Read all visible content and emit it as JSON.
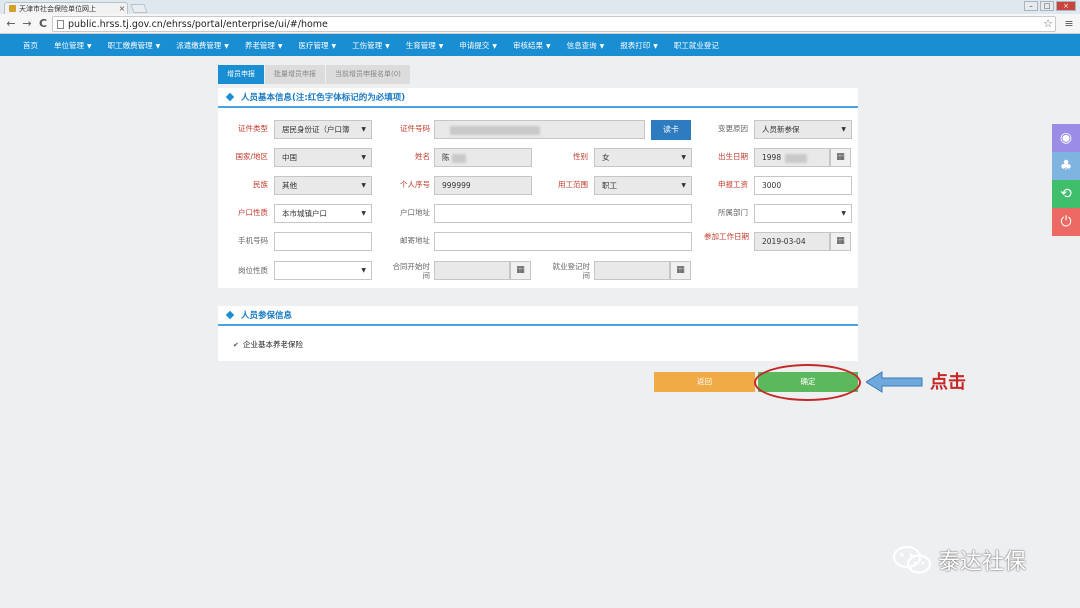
{
  "browser": {
    "tab_title": "天津市社会保险单位网上",
    "tab_close": "×",
    "url": "public.hrss.tj.gov.cn/ehrss/portal/enterprise/ui/#/home",
    "back": "←",
    "forward": "→",
    "reload": "C",
    "star": "☆",
    "menu": "≡",
    "win_min": "–",
    "win_max": "□",
    "win_close": "×"
  },
  "nav": {
    "items": [
      {
        "label": "首页",
        "caret": ""
      },
      {
        "label": "单位管理",
        "caret": "▼"
      },
      {
        "label": "职工缴费管理",
        "caret": "▼"
      },
      {
        "label": "派遣缴费管理",
        "caret": "▼"
      },
      {
        "label": "养老管理",
        "caret": "▼"
      },
      {
        "label": "医疗管理",
        "caret": "▼"
      },
      {
        "label": "工伤管理",
        "caret": "▼"
      },
      {
        "label": "生育管理",
        "caret": "▼"
      },
      {
        "label": "申请提交",
        "caret": "▼"
      },
      {
        "label": "审核结果",
        "caret": "▼"
      },
      {
        "label": "信息查询",
        "caret": "▼"
      },
      {
        "label": "报表打印",
        "caret": "▼"
      },
      {
        "label": "职工就业登记",
        "caret": ""
      }
    ]
  },
  "tabs": [
    "增员申报",
    "批量增员申报",
    "当前增员申报名单(0)"
  ],
  "basic": {
    "title": "人员基本信息(注:红色字体标记的为必填项)",
    "id_type_label": "证件类型",
    "id_type_value": "居民身份证（户口簿",
    "id_no_label": "证件号码",
    "read_card": "读卡",
    "change_reason_label": "变更原因",
    "change_reason_value": "人员新参保",
    "country_label": "国家/地区",
    "country_value": "中国",
    "name_label": "姓名",
    "name_value": "陈",
    "gender_label": "性别",
    "gender_value": "女",
    "birth_label": "出生日期",
    "birth_value": "1998",
    "ethnic_label": "民族",
    "ethnic_value": "其他",
    "serial_label": "个人序号",
    "serial_value": "999999",
    "emp_scope_label": "用工范围",
    "emp_scope_value": "职工",
    "wage_label": "申报工资",
    "wage_value": "3000",
    "hukou_label": "户口性质",
    "hukou_value": "本市城镇户口",
    "hukou_addr_label": "户口地址",
    "dept_label": "所属部门",
    "phone_label": "手机号码",
    "mail_addr_label": "邮寄地址",
    "work_date_label": "参加工作日期",
    "work_date_value": "2019-03-04",
    "post_label": "岗位性质",
    "contract_label": "合同开始时间",
    "reg_label": "就业登记时间",
    "dropdown": "▼",
    "calendar": "▦"
  },
  "insurance": {
    "title": "人员参保信息",
    "checkmark": "✔",
    "item": "企业基本养老保险"
  },
  "actions": {
    "cancel": "返回",
    "ok": "确定"
  },
  "annotation": {
    "click": "点击"
  },
  "watermark": {
    "text": "泰达社保"
  },
  "colors": {
    "brand": "#1a8ed3",
    "required": "#c0392b",
    "cancel": "#f0ab47",
    "confirm": "#5cb85c"
  }
}
